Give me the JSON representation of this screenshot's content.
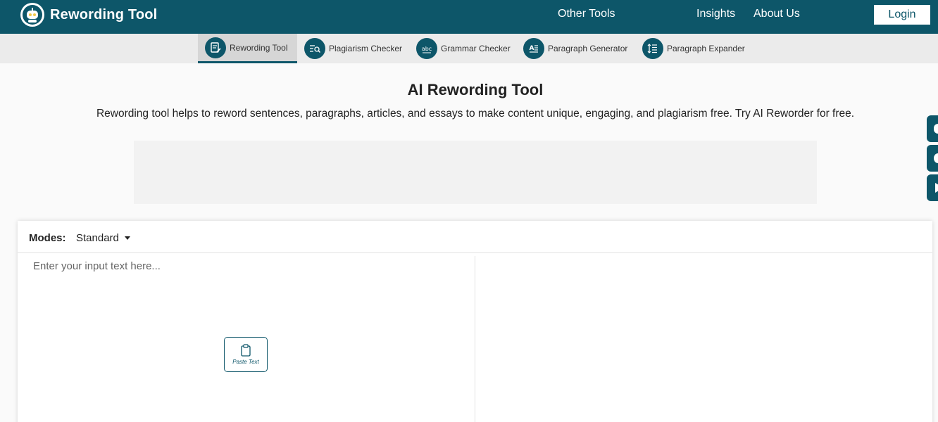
{
  "header": {
    "brand_name": "Rewording Tool",
    "nav": {
      "other_tools": "Other Tools",
      "insights": "Insights",
      "about_us": "About Us"
    },
    "login_label": "Login"
  },
  "tool_tabs": [
    {
      "label": "Rewording Tool",
      "icon": "rewording-icon",
      "active": true
    },
    {
      "label": "Plagiarism Checker",
      "icon": "plagiarism-icon",
      "active": false
    },
    {
      "label": "Grammar Checker",
      "icon": "grammar-icon",
      "active": false
    },
    {
      "label": "Paragraph Generator",
      "icon": "paragraph-generator-icon",
      "active": false
    },
    {
      "label": "Paragraph Expander",
      "icon": "paragraph-expander-icon",
      "active": false
    }
  ],
  "hero": {
    "title": "AI Rewording Tool",
    "description": "Rewording tool helps to reword sentences, paragraphs, articles, and essays to make content unique, engaging, and plagiarism free. Try AI Reworder for free."
  },
  "editor": {
    "modes_label": "Modes:",
    "mode_selected": "Standard",
    "input_placeholder": "Enter your input text here...",
    "paste_label": "Paste Text"
  },
  "side_buttons": [
    "chat-icon",
    "heart-icon",
    "play-icon"
  ],
  "colors": {
    "brand": "#0d5669",
    "tab_bar": "#ebebeb",
    "tab_active": "#d6d6d6",
    "page_bg": "#fafafa",
    "ad_bg": "#f2f2f2"
  }
}
